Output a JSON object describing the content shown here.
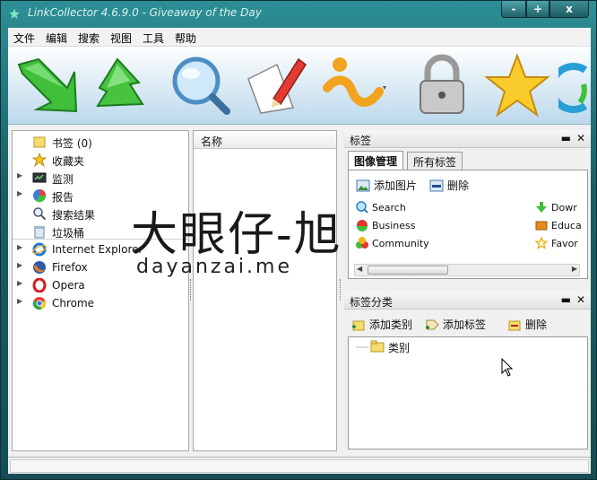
{
  "window": {
    "title": "LinkCollector 4.6.9.0 - Giveaway of the Day",
    "caption_buttons": {
      "minimize": "-",
      "maximize": "+",
      "close": "x"
    }
  },
  "menubar": {
    "items": [
      "文件",
      "编辑",
      "搜索",
      "视图",
      "工具",
      "帮助"
    ]
  },
  "toolbar": {
    "buttons": [
      {
        "icon": "green-arrow-down-icon"
      },
      {
        "icon": "green-arrow-up-icon"
      },
      {
        "icon": "magnifier-icon"
      },
      {
        "icon": "paper-pencil-icon"
      },
      {
        "icon": "wave-info-icon"
      },
      {
        "icon": "padlock-icon"
      },
      {
        "icon": "star-icon"
      },
      {
        "icon": "refresh-icon"
      }
    ]
  },
  "tree": {
    "items": [
      {
        "label": "书签 (0)",
        "icon": "bookmark-folder-icon",
        "has_arrow": false
      },
      {
        "label": "收藏夹",
        "icon": "favorites-star-icon",
        "has_arrow": false
      },
      {
        "label": "监测",
        "icon": "monitor-icon",
        "has_arrow": true
      },
      {
        "label": "报告",
        "icon": "report-chart-icon",
        "has_arrow": true
      },
      {
        "label": "搜索结果",
        "icon": "search-results-icon",
        "has_arrow": false
      },
      {
        "label": "垃圾桶",
        "icon": "trash-icon",
        "has_arrow": false
      }
    ],
    "browsers": [
      {
        "label": "Internet Explorer",
        "icon": "ie-icon"
      },
      {
        "label": "Firefox",
        "icon": "firefox-icon"
      },
      {
        "label": "Opera",
        "icon": "opera-icon"
      },
      {
        "label": "Chrome",
        "icon": "chrome-icon"
      }
    ]
  },
  "list": {
    "column_header": "名称"
  },
  "tags_pane": {
    "title": "标签",
    "tabs": [
      {
        "label": "图像管理",
        "active": true
      },
      {
        "label": "所有标签",
        "active": false
      }
    ],
    "actions": {
      "add_image": "添加图片",
      "delete": "删除"
    },
    "tags_left": [
      {
        "label": "Search",
        "icon": "search-tag-icon"
      },
      {
        "label": "Business",
        "icon": "business-tag-icon"
      },
      {
        "label": "Community",
        "icon": "community-tag-icon"
      }
    ],
    "tags_right": [
      {
        "label": "Dowr",
        "icon": "download-tag-icon"
      },
      {
        "label": "Educa",
        "icon": "education-tag-icon"
      },
      {
        "label": "Favor",
        "icon": "favorites-tag-icon"
      }
    ]
  },
  "category_pane": {
    "title": "标签分类",
    "actions": {
      "add_category": "添加类别",
      "add_tag": "添加标签",
      "delete": "删除"
    },
    "root": "类别"
  },
  "watermark": {
    "cn": "大眼仔-旭",
    "en": "dayanzai.me"
  }
}
